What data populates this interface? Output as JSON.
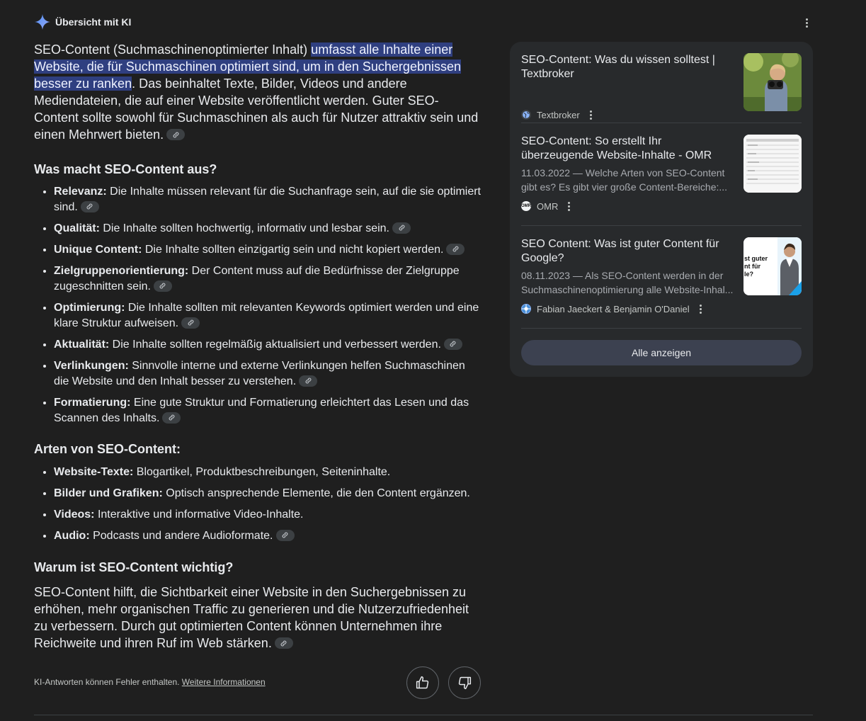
{
  "header": {
    "title": "Übersicht mit KI"
  },
  "intro": {
    "part1": "SEO-Content (Suchmaschinenoptimierter Inhalt) ",
    "highlight": "umfasst alle Inhalte einer Website, die für Suchmaschinen optimiert sind, um in den Suchergebnissen besser zu ranken",
    "part2": ". Das beinhaltet Texte, Bilder, Videos und andere Mediendateien, die auf einer Website veröffentlicht werden. Guter SEO-Content sollte sowohl für Suchmaschinen als auch für Nutzer attraktiv sein und einen Mehrwert bieten."
  },
  "section1": {
    "heading": "Was macht SEO-Content aus?",
    "items": [
      {
        "term": "Relevanz:",
        "text": " Die Inhalte müssen relevant für die Suchanfrage sein, auf die sie optimiert sind."
      },
      {
        "term": "Qualität:",
        "text": " Die Inhalte sollten hochwertig, informativ und lesbar sein."
      },
      {
        "term": "Unique Content:",
        "text": " Die Inhalte sollten einzigartig sein und nicht kopiert werden."
      },
      {
        "term": "Zielgruppenorientierung:",
        "text": " Der Content muss auf die Bedürfnisse der Zielgruppe zugeschnitten sein."
      },
      {
        "term": "Optimierung:",
        "text": " Die Inhalte sollten mit relevanten Keywords optimiert werden und eine klare Struktur aufweisen."
      },
      {
        "term": "Aktualität:",
        "text": " Die Inhalte sollten regelmäßig aktualisiert und verbessert werden."
      },
      {
        "term": "Verlinkungen:",
        "text": " Sinnvolle interne und externe Verlinkungen helfen Suchmaschinen die Website und den Inhalt besser zu verstehen."
      },
      {
        "term": "Formatierung:",
        "text": " Eine gute Struktur und Formatierung erleichtert das Lesen und das Scannen des Inhalts."
      }
    ]
  },
  "section2": {
    "heading": "Arten von SEO-Content:",
    "items": [
      {
        "term": "Website-Texte:",
        "text": " Blogartikel, Produktbeschreibungen, Seiteninhalte."
      },
      {
        "term": "Bilder und Grafiken:",
        "text": " Optisch ansprechende Elemente, die den Content ergänzen."
      },
      {
        "term": "Videos:",
        "text": " Interaktive und informative Video-Inhalte."
      },
      {
        "term": "Audio:",
        "text": " Podcasts und andere Audioformate."
      }
    ]
  },
  "section3": {
    "heading": "Warum ist SEO-Content wichtig?",
    "text": "SEO-Content hilft, die Sichtbarkeit einer Website in den Suchergebnissen zu erhöhen, mehr organischen Traffic zu generieren und die Nutzerzufriedenheit zu verbessern. Durch gut optimierten Content können Unternehmen ihre Reichweite und ihren Ruf im Web stärken."
  },
  "footer": {
    "disclaimer": "KI-Antworten können Fehler enthalten. ",
    "more_link": "Weitere Informationen"
  },
  "sources": {
    "cards": [
      {
        "title": "SEO-Content: Was du wissen solltest | Textbroker",
        "snippet_lines": [],
        "source": "Textbroker",
        "icon": "globe-icon"
      },
      {
        "title": "SEO-Content: So erstellt Ihr überzeugende Website-Inhalte - OMR",
        "snippet_lines": [
          "11.03.2022 — Welche Arten von SEO-Content",
          "gibt es? Es gibt vier große Content-Bereiche:..."
        ],
        "source": "OMR",
        "icon": "omr-icon"
      },
      {
        "title": "SEO Content: Was ist guter Content für Google?",
        "snippet_lines": [
          "08.11.2023 — Als SEO-Content werden in der",
          "Suchmaschinenoptimierung alle Website-Inhal..."
        ],
        "source": "Fabian Jaeckert & Benjamin O'Daniel",
        "icon": "site-icon"
      }
    ],
    "thumb3_text": [
      "st guter",
      "nt für",
      "le?"
    ],
    "show_all": "Alle anzeigen"
  },
  "colors": {
    "background": "#1f1f1f",
    "panel": "#282a2c",
    "highlight": "#2f3f80",
    "button": "#3c4150"
  }
}
